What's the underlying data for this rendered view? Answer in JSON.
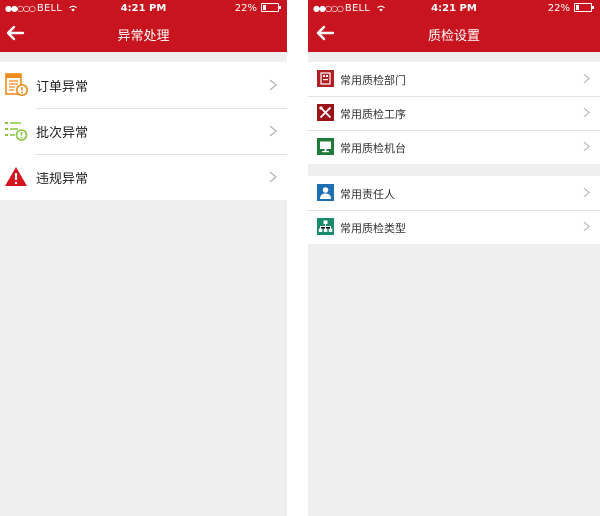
{
  "left": {
    "status": {
      "carrier": "BELL",
      "time": "4:21 PM",
      "battery": "22%",
      "battery_level": 0.22
    },
    "title": "异常处理",
    "items": [
      {
        "label": "订单异常",
        "icon": "order-exception-icon"
      },
      {
        "label": "批次异常",
        "icon": "batch-exception-icon"
      },
      {
        "label": "违规异常",
        "icon": "warning-icon"
      }
    ]
  },
  "right": {
    "status": {
      "carrier": "BELL",
      "time": "4:21 PM",
      "battery": "22%",
      "battery_level": 0.22
    },
    "title": "质检设置",
    "group1": [
      {
        "label": "常用质检部门",
        "icon": "department-icon"
      },
      {
        "label": "常用质检工序",
        "icon": "tools-icon"
      },
      {
        "label": "常用质检机台",
        "icon": "monitor-icon"
      }
    ],
    "group2": [
      {
        "label": "常用责任人",
        "icon": "person-icon"
      },
      {
        "label": "常用质检类型",
        "icon": "hierarchy-icon"
      }
    ]
  },
  "colors": {
    "header": "#c8141e",
    "background": "#efefef",
    "orange_icon": "#f08a1c",
    "green_icon": "#8cc63f",
    "dark_red_icon": "#b01e24",
    "dark_green_icon": "#1f7a3a",
    "blue_icon": "#1e6fb2",
    "teal_icon": "#1a8a6a"
  }
}
